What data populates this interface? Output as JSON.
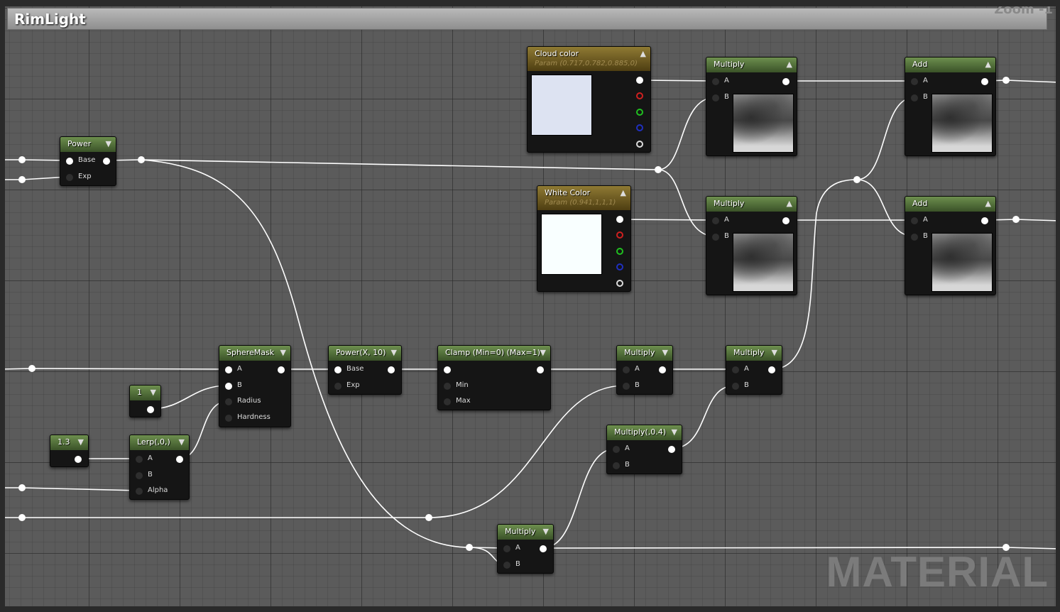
{
  "comment": {
    "title": "RimLight"
  },
  "zoom_label": "Zoom -1",
  "watermark": "MATERIAL",
  "icons": {
    "collapse": "chevron-down-icon",
    "expand": "triangle-up-icon"
  },
  "colors": {
    "node_header": "#3a5228",
    "param_header": "#4e3e12",
    "wire": "#ffffff"
  },
  "nodes": {
    "power": {
      "title": "Power",
      "pins": [
        "Base",
        "Exp"
      ]
    },
    "cloud": {
      "title": "Cloud color",
      "subtitle": "Param (0.717,0.782,0.885,0)",
      "swatch": "#dde3f2"
    },
    "white": {
      "title": "White Color",
      "subtitle": "Param (0.941,1,1,1)",
      "swatch": "#f9ffff"
    },
    "mul1": {
      "title": "Multiply",
      "pins": [
        "A",
        "B"
      ]
    },
    "mul2": {
      "title": "Multiply",
      "pins": [
        "A",
        "B"
      ]
    },
    "add1": {
      "title": "Add",
      "pins": [
        "A",
        "B"
      ]
    },
    "add2": {
      "title": "Add",
      "pins": [
        "A",
        "B"
      ]
    },
    "spheremask": {
      "title": "SphereMask",
      "pins": [
        "A",
        "B",
        "Radius",
        "Hardness"
      ]
    },
    "const1": {
      "title": "1"
    },
    "const13": {
      "title": "1.3"
    },
    "lerp": {
      "title": "Lerp(,0,)",
      "pins": [
        "A",
        "B",
        "Alpha"
      ]
    },
    "powx": {
      "title": "Power(X, 10)",
      "pins": [
        "Base",
        "Exp"
      ]
    },
    "clamp": {
      "title": "Clamp (Min=0) (Max=1)",
      "pins": [
        "Min",
        "Max"
      ]
    },
    "mul3": {
      "title": "Multiply",
      "pins": [
        "A",
        "B"
      ]
    },
    "mul4": {
      "title": "Multiply",
      "pins": [
        "A",
        "B"
      ]
    },
    "mul04": {
      "title": "Multiply(,0.4)",
      "pins": [
        "A",
        "B"
      ]
    },
    "mul5": {
      "title": "Multiply",
      "pins": [
        "A",
        "B"
      ]
    }
  }
}
